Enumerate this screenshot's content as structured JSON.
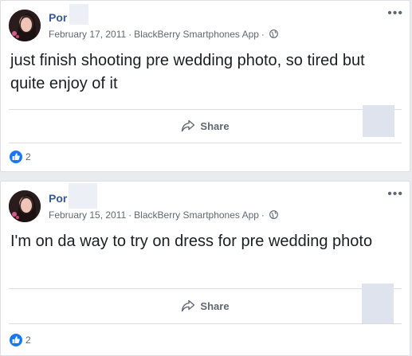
{
  "posts": [
    {
      "author": "Por",
      "date": "February 17, 2011",
      "source": "BlackBerry Smartphones App",
      "privacy_icon": "globe-icon",
      "text": "just finish shooting pre wedding photo, so tired but quite enjoy of it",
      "share_label": "Share",
      "like_count": "2"
    },
    {
      "author": "Por",
      "date": "February 15, 2011",
      "source": "BlackBerry Smartphones App",
      "privacy_icon": "globe-icon",
      "text": "I'm on da way to try on dress for pre wedding photo",
      "share_label": "Share",
      "like_count": "2"
    }
  ],
  "colors": {
    "author_link": "#365899",
    "meta_text": "#616770",
    "body_text": "#1c1e21",
    "like_blue": "#1877f2",
    "feed_background": "#e9ebee"
  }
}
